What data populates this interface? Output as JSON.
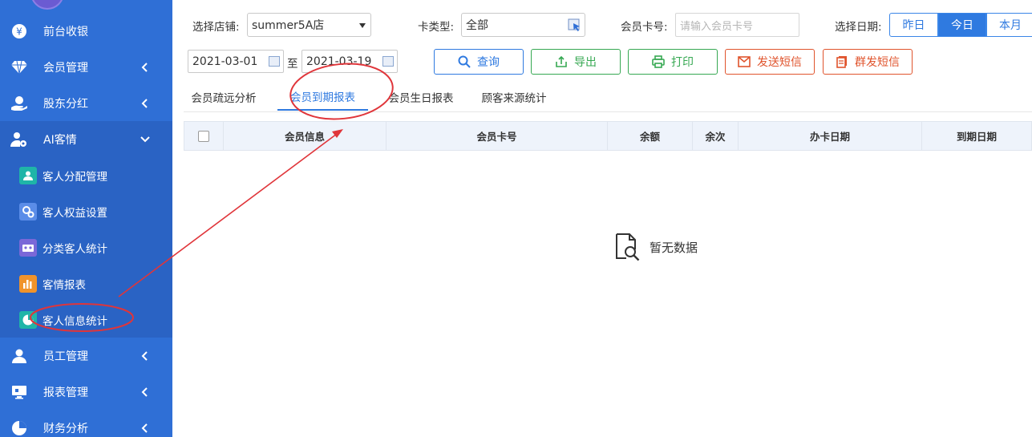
{
  "sidebar": {
    "items": [
      {
        "label": "前台收银",
        "icon": "yen-coin-icon",
        "has_chevron": false
      },
      {
        "label": "会员管理",
        "icon": "diamond-icon",
        "has_chevron": true
      },
      {
        "label": "股东分红",
        "icon": "hand-coin-icon",
        "has_chevron": true
      },
      {
        "label": "AI客情",
        "icon": "user-settings-icon",
        "has_chevron": true,
        "expanded": true
      },
      {
        "label": "员工管理",
        "icon": "user-icon",
        "has_chevron": true
      },
      {
        "label": "报表管理",
        "icon": "monitor-icon",
        "has_chevron": true
      },
      {
        "label": "财务分析",
        "icon": "pie-chart-icon",
        "has_chevron": true
      }
    ],
    "subitems": [
      {
        "label": "客人分配管理",
        "icon": "person-card-icon",
        "color": "#1fb5a8"
      },
      {
        "label": "客人权益设置",
        "icon": "gears-icon",
        "color": "#5b8de8"
      },
      {
        "label": "分类客人统计",
        "icon": "group-icon",
        "color": "#7a68d8"
      },
      {
        "label": "客情报表",
        "icon": "bar-chart-icon",
        "color": "#f0932b"
      },
      {
        "label": "客人信息统计",
        "icon": "pie-icon",
        "color": "#1fb5a8"
      }
    ]
  },
  "filters": {
    "store_label": "选择店铺:",
    "store_value": "summer5A店",
    "card_type_label": "卡类型:",
    "card_type_value": "全部",
    "card_no_label": "会员卡号:",
    "card_no_placeholder": "请输入会员卡号",
    "date_label": "选择日期:",
    "date_options": [
      "昨日",
      "今日",
      "本月"
    ],
    "date_selected": "今日",
    "start_date": "2021-03-01",
    "to_label": "至",
    "end_date": "2021-03-19"
  },
  "buttons": {
    "query": "查询",
    "export": "导出",
    "print": "打印",
    "send_sms": "发送短信",
    "bulk_sms": "群发短信"
  },
  "tabs": [
    {
      "label": "会员疏远分析"
    },
    {
      "label": "会员到期报表",
      "active": true
    },
    {
      "label": "会员生日报表"
    },
    {
      "label": "顾客来源统计"
    }
  ],
  "table": {
    "columns": [
      "会员信息",
      "会员卡号",
      "余额",
      "余次",
      "办卡日期",
      "到期日期"
    ],
    "empty_text": "暂无数据"
  },
  "colors": {
    "sidebar_bg": "#2f6fd6",
    "accent": "#2f7ae0",
    "annotation": "#e0353a"
  }
}
